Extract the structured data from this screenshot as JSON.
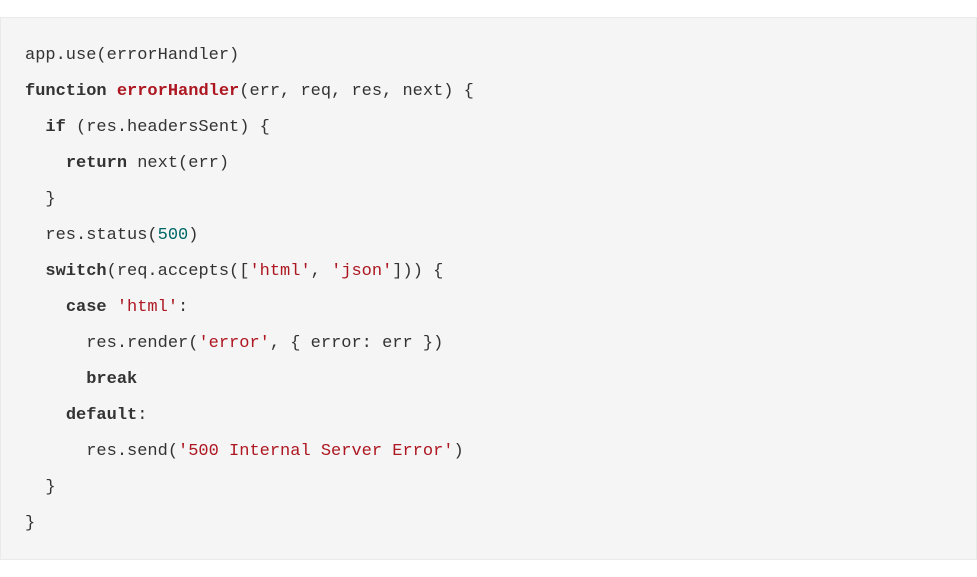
{
  "code": {
    "lines": [
      [
        {
          "t": "app.use(errorHandler)",
          "c": ""
        }
      ],
      [
        {
          "t": "function",
          "c": "tok-keyword"
        },
        {
          "t": " ",
          "c": ""
        },
        {
          "t": "errorHandler",
          "c": "tok-funcdef"
        },
        {
          "t": "(err, req, res, next) {",
          "c": ""
        }
      ],
      [
        {
          "t": "  ",
          "c": ""
        },
        {
          "t": "if",
          "c": "tok-keyword"
        },
        {
          "t": " (res.headersSent) {",
          "c": ""
        }
      ],
      [
        {
          "t": "    ",
          "c": ""
        },
        {
          "t": "return",
          "c": "tok-keyword"
        },
        {
          "t": " next(err)",
          "c": ""
        }
      ],
      [
        {
          "t": "  }",
          "c": ""
        }
      ],
      [
        {
          "t": "  res.status(",
          "c": ""
        },
        {
          "t": "500",
          "c": "tok-number"
        },
        {
          "t": ")",
          "c": ""
        }
      ],
      [
        {
          "t": "  ",
          "c": ""
        },
        {
          "t": "switch",
          "c": "tok-keyword"
        },
        {
          "t": "(req.accepts([",
          "c": ""
        },
        {
          "t": "'html'",
          "c": "tok-string"
        },
        {
          "t": ", ",
          "c": ""
        },
        {
          "t": "'json'",
          "c": "tok-string"
        },
        {
          "t": "])) {",
          "c": ""
        }
      ],
      [
        {
          "t": "    ",
          "c": ""
        },
        {
          "t": "case",
          "c": "tok-keyword"
        },
        {
          "t": " ",
          "c": ""
        },
        {
          "t": "'html'",
          "c": "tok-string"
        },
        {
          "t": ":",
          "c": ""
        }
      ],
      [
        {
          "t": "      res.render(",
          "c": ""
        },
        {
          "t": "'error'",
          "c": "tok-string"
        },
        {
          "t": ", { error: err })",
          "c": ""
        }
      ],
      [
        {
          "t": "      ",
          "c": ""
        },
        {
          "t": "break",
          "c": "tok-keyword"
        }
      ],
      [
        {
          "t": "    ",
          "c": ""
        },
        {
          "t": "default",
          "c": "tok-keyword"
        },
        {
          "t": ":",
          "c": ""
        }
      ],
      [
        {
          "t": "      res.send(",
          "c": ""
        },
        {
          "t": "'500 Internal Server Error'",
          "c": "tok-string"
        },
        {
          "t": ")",
          "c": ""
        }
      ],
      [
        {
          "t": "  }",
          "c": ""
        }
      ],
      [
        {
          "t": "}",
          "c": ""
        }
      ]
    ]
  }
}
